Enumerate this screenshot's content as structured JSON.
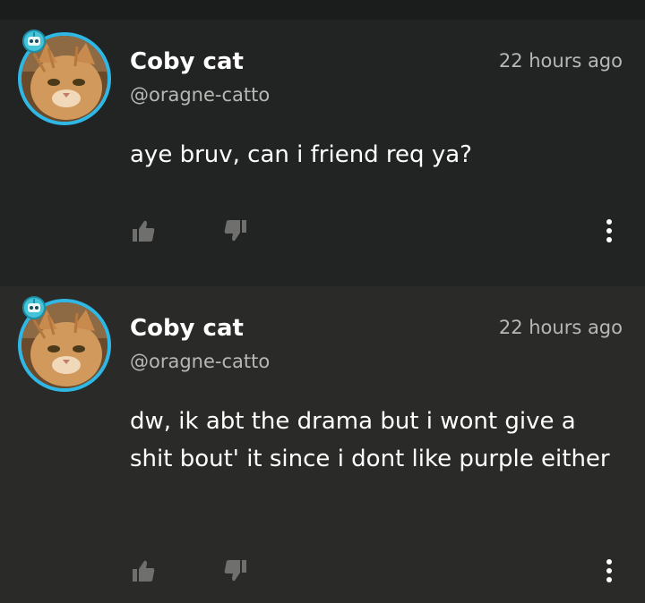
{
  "comments": [
    {
      "author": "Coby cat",
      "handle": "@oragne-catto",
      "time": "22 hours ago",
      "text": "aye bruv, can i friend req ya?"
    },
    {
      "author": "Coby cat",
      "handle": "@oragne-catto",
      "time": "22 hours ago",
      "text": "dw, ik abt the drama but i wont give a shit bout' it since i dont like purple either"
    }
  ],
  "colors": {
    "background": "#222423",
    "background_alt": "#2a2b29",
    "avatar_ring": "#2fb8e6",
    "secondary_text": "#b7b8b6"
  },
  "icons": {
    "like": "thumbs-up-icon",
    "dislike": "thumbs-down-icon",
    "more": "more-vertical-icon",
    "badge": "robot-badge-icon"
  }
}
